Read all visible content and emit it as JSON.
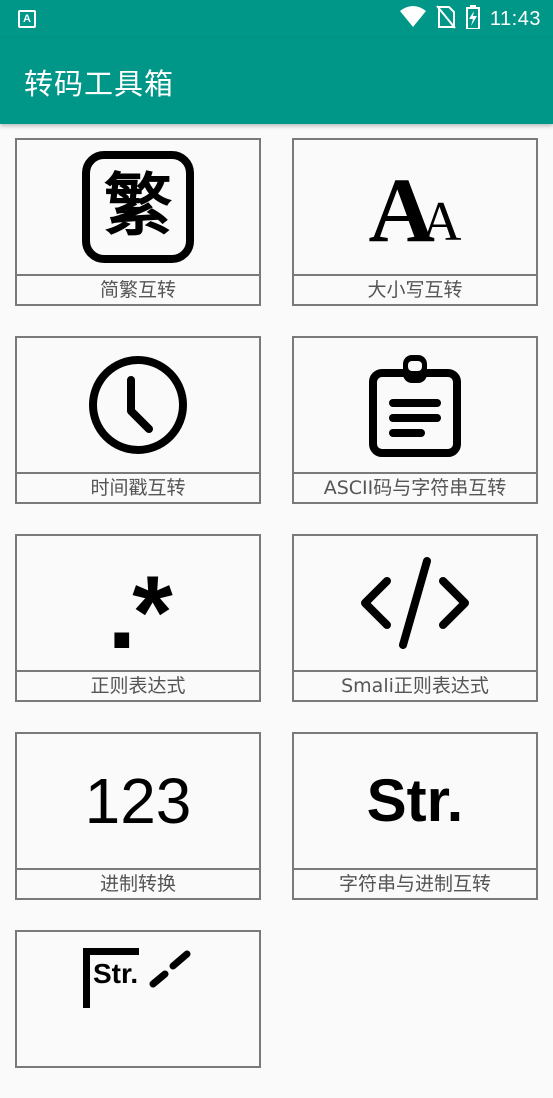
{
  "status_bar": {
    "left_icon": "A",
    "time": "11:43",
    "icons": [
      "wifi-icon",
      "no-sim-icon",
      "battery-charging-icon"
    ]
  },
  "app_bar": {
    "title": "转码工具箱"
  },
  "tools": [
    {
      "label": "简繁互转",
      "icon": "traditional-char-icon",
      "glyph": "繁"
    },
    {
      "label": "大小写互转",
      "icon": "case-icon",
      "glyph": "AA"
    },
    {
      "label": "时间戳互转",
      "icon": "clock-icon"
    },
    {
      "label": "ASCII码与字符串互转",
      "icon": "clipboard-icon"
    },
    {
      "label": "正则表达式",
      "icon": "regex-icon",
      "glyph": ".*"
    },
    {
      "label": "Smali正则表达式",
      "icon": "code-icon"
    },
    {
      "label": "进制转换",
      "icon": "number-icon",
      "glyph": "123"
    },
    {
      "label": "字符串与进制互转",
      "icon": "string-icon",
      "glyph": "Str."
    },
    {
      "label": "",
      "icon": "string-edit-icon",
      "glyph": "Str."
    }
  ]
}
